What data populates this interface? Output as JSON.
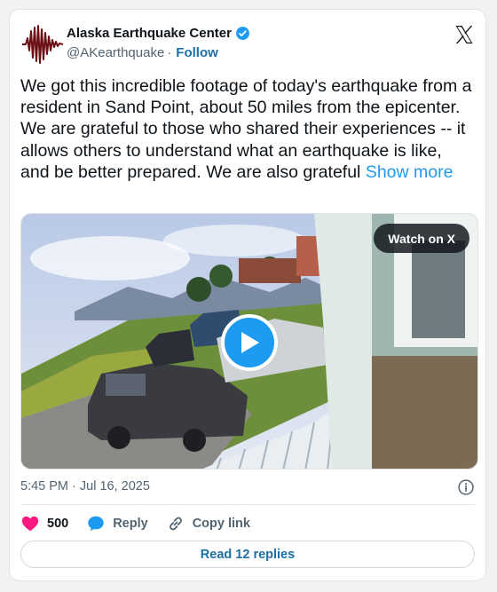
{
  "account": {
    "name": "Alaska Earthquake Center",
    "handle": "@AKearthquake",
    "separator": "·",
    "follow_label": "Follow"
  },
  "tweet": {
    "text": "We got this incredible footage of today's earthquake from a resident in Sand Point, about 50 miles from the epicenter. We are grateful to those who shared their experiences -- it allows others to understand what an earthquake is like, and be better prepared. We are also grateful",
    "show_more_label": "Show more",
    "timestamp": "5:45 PM · Jul 16, 2025"
  },
  "media": {
    "watch_label": "Watch on X"
  },
  "actions": {
    "like_count": "500",
    "reply_label": "Reply",
    "copy_link_label": "Copy link"
  },
  "footer": {
    "read_replies_label": "Read 12 replies"
  },
  "colors": {
    "accent": "#1d9bf0",
    "link": "#1d6fa5",
    "like": "#f91880",
    "secondary_text": "#536471"
  },
  "icons": {
    "avatar": "seismograph-icon",
    "verified": "verified-badge-icon",
    "brand": "x-logo-icon",
    "play": "play-icon",
    "info": "info-icon",
    "like": "heart-icon",
    "reply": "reply-bubble-icon",
    "copy_link": "link-icon"
  }
}
